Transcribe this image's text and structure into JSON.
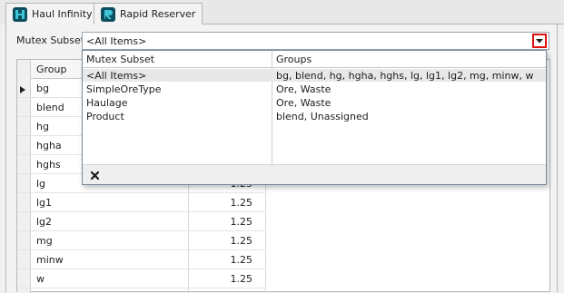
{
  "tabs": [
    {
      "label": "Haul Infinity",
      "icon": "haul-infinity-logo-icon"
    },
    {
      "label": "Rapid Reserver",
      "icon": "rapid-reserver-logo-icon"
    }
  ],
  "mutex": {
    "label": "Mutex Subset",
    "value": "<All Items>"
  },
  "grid": {
    "column_group": "Group",
    "rows": [
      {
        "group": "bg",
        "value": "",
        "current": true
      },
      {
        "group": "blend",
        "value": ""
      },
      {
        "group": "hg",
        "value": ""
      },
      {
        "group": "hgha",
        "value": ""
      },
      {
        "group": "hghs",
        "value": ""
      },
      {
        "group": "lg",
        "value": "1.25"
      },
      {
        "group": "lg1",
        "value": "1.25"
      },
      {
        "group": "lg2",
        "value": "1.25"
      },
      {
        "group": "mg",
        "value": "1.25"
      },
      {
        "group": "minw",
        "value": "1.25"
      },
      {
        "group": "w",
        "value": "1.25"
      }
    ]
  },
  "dropdown": {
    "col1_header": "Mutex Subset",
    "col2_header": "Groups",
    "rows": [
      {
        "subset": "<All Items>",
        "groups": "bg, blend, hg, hgha, hghs, lg, lg1, lg2, mg, minw, w",
        "selected": true
      },
      {
        "subset": "SimpleOreType",
        "groups": "Ore, Waste"
      },
      {
        "subset": "Haulage",
        "groups": "Ore, Waste"
      },
      {
        "subset": "Product",
        "groups": "blend, Unassigned"
      }
    ]
  },
  "colors": {
    "highlight": "#e01010",
    "logo": "#0d4e5e",
    "logo_accent": "#3ec6d8"
  }
}
